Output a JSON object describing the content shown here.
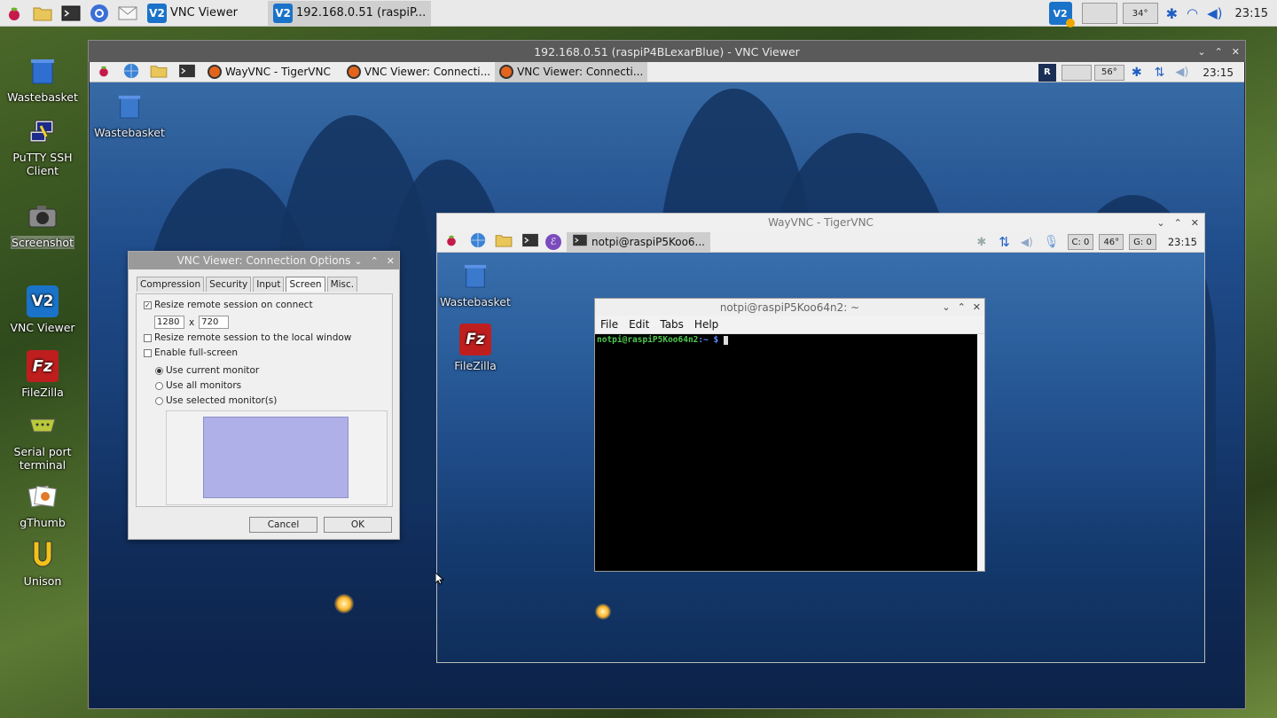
{
  "taskbar": {
    "tasks": [
      {
        "label": "VNC Viewer",
        "icon": "vnc-viewer-icon"
      },
      {
        "label": "192.168.0.51 (raspiP...",
        "icon": "vnc-viewer-icon"
      }
    ],
    "tray": {
      "temp": "34°",
      "clock": "23:15"
    }
  },
  "desktop_icons": [
    {
      "label": "Wastebasket",
      "icon": "trash-icon"
    },
    {
      "label": "PuTTY SSH Client",
      "icon": "putty-icon"
    },
    {
      "label": "Screenshot",
      "icon": "camera-icon"
    },
    {
      "label": "VNC Viewer",
      "icon": "vnc-viewer-icon"
    },
    {
      "label": "FileZilla",
      "icon": "filezilla-icon"
    },
    {
      "label": "Serial port terminal",
      "icon": "serial-port-icon"
    },
    {
      "label": "gThumb",
      "icon": "gthumb-icon"
    },
    {
      "label": "Unison",
      "icon": "unison-icon"
    }
  ],
  "vnc_window": {
    "title": "192.168.0.51 (raspiP4BLexarBlue) - VNC Viewer",
    "taskbar": {
      "tasks": [
        "WayVNC - TigerVNC",
        "VNC Viewer: Connecti...",
        "VNC Viewer: Connecti..."
      ],
      "temp": "56°",
      "clock": "23:15"
    },
    "desktop_icon": "Wastebasket"
  },
  "wayvnc_window": {
    "title": "WayVNC - TigerVNC",
    "task": "notpi@raspiP5Koo6...",
    "cpu": "C: 0",
    "temp": "46°",
    "gpu": "G: 0",
    "clock": "23:15",
    "desktop_icons": [
      "Wastebasket",
      "FileZilla"
    ]
  },
  "terminal": {
    "title": "notpi@raspiP5Koo64n2: ~",
    "menu": [
      "File",
      "Edit",
      "Tabs",
      "Help"
    ],
    "prompt_user": "notpi@raspiP5Koo64n2",
    "prompt_rest": ":~ $ "
  },
  "options_dialog": {
    "title": "VNC Viewer: Connection Options",
    "tabs": [
      "Compression",
      "Security",
      "Input",
      "Screen",
      "Misc."
    ],
    "resize_on_connect": "Resize remote session on connect",
    "width": "1280",
    "x": "x",
    "height": "720",
    "resize_local": "Resize remote session to the local window",
    "fullscreen": "Enable full-screen",
    "use_current": "Use current monitor",
    "use_all": "Use all monitors",
    "use_selected": "Use selected monitor(s)",
    "cancel": "Cancel",
    "ok": "OK",
    "monitor_color": "#b0b0e8"
  },
  "colors": {
    "terminal_green": "#4ec94e",
    "terminal_blue": "#5b8cff"
  }
}
